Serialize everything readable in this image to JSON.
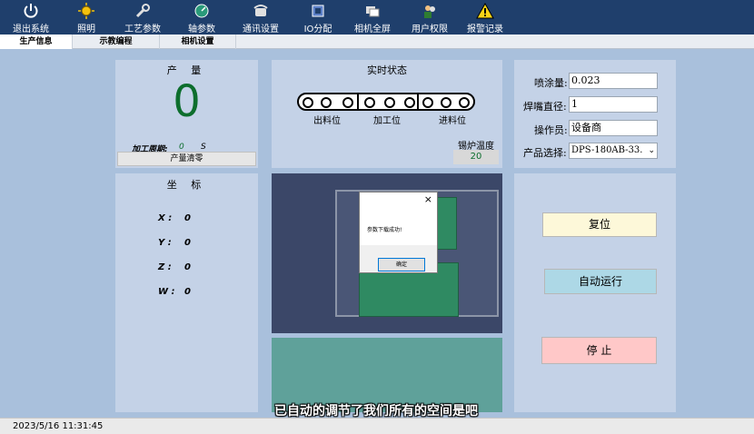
{
  "toolbar": {
    "items": [
      {
        "label": "退出系统",
        "icon": "power-icon"
      },
      {
        "label": "照明",
        "icon": "sun-icon"
      },
      {
        "label": "工艺参数",
        "icon": "wrench-icon"
      },
      {
        "label": "轴参数",
        "icon": "gauge-icon"
      },
      {
        "label": "通讯设置",
        "icon": "phone-icon"
      },
      {
        "label": "IO分配",
        "icon": "io-board-icon"
      },
      {
        "label": "相机全屏",
        "icon": "windows-icon"
      },
      {
        "label": "用户权限",
        "icon": "users-icon"
      },
      {
        "label": "报警记录",
        "icon": "warning-icon"
      }
    ]
  },
  "tabs": [
    {
      "label": "生产信息",
      "active": true
    },
    {
      "label": "示教编程",
      "active": false
    },
    {
      "label": "相机设置",
      "active": false
    }
  ],
  "output": {
    "title": "产 量",
    "count": "0",
    "cycle_label": "加工周期:",
    "cycle_value": "0",
    "cycle_unit": "S",
    "clear_button": "产量清零"
  },
  "realtime": {
    "title": "实时状态",
    "positions": [
      "出料位",
      "加工位",
      "进料位"
    ],
    "temp_label": "锡炉温度",
    "temp_value": "20"
  },
  "params": {
    "spray_label": "喷涂量:",
    "spray_value": "0.023",
    "nozzle_label": "焊嘴直径:",
    "nozzle_value": "1",
    "operator_label": "操作员:",
    "operator_value": "设备商",
    "product_label": "产品选择:",
    "product_value": "DPS-180AB-33."
  },
  "coordinates": {
    "title": "坐 标",
    "items": [
      {
        "label": "X :",
        "value": "0"
      },
      {
        "label": "Y :",
        "value": "0"
      },
      {
        "label": "Z :",
        "value": "0"
      },
      {
        "label": "W :",
        "value": "0"
      }
    ]
  },
  "dialog": {
    "message": "参数下载成功!",
    "ok": "确定",
    "close": "×"
  },
  "actions": {
    "reset": "复位",
    "auto_run": "自动运行",
    "stop": "停 止"
  },
  "subtitle": "已自动的调节了我们所有的空间是吧",
  "status": {
    "datetime": "2023/5/16 11:31:45"
  },
  "colors": {
    "toolbar": "#1f3f6c",
    "panel": "#c4d2e7",
    "reset_button": "#fdf8d9",
    "auto_button": "#add8e6",
    "stop_button": "#ffc8c8",
    "count_text": "#0d6e2d"
  }
}
